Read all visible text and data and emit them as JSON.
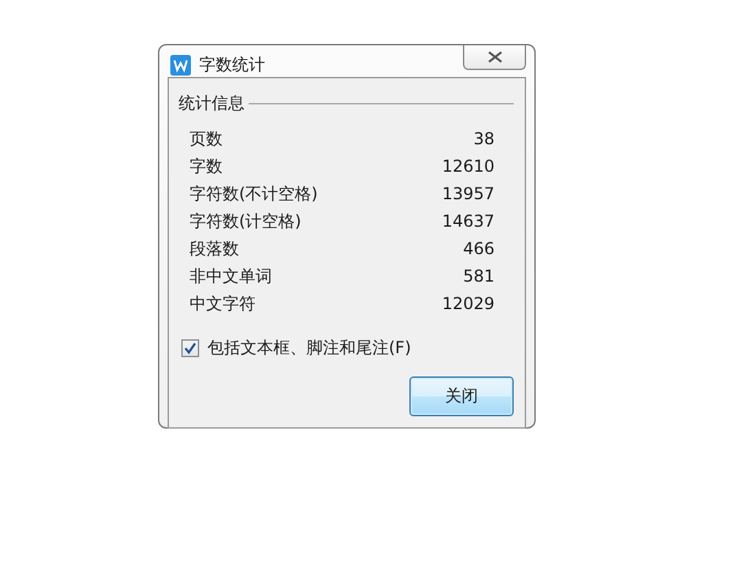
{
  "window": {
    "title": "字数统计"
  },
  "group": {
    "title": "统计信息"
  },
  "stats": [
    {
      "label": "页数",
      "value": "38"
    },
    {
      "label": "字数",
      "value": "12610"
    },
    {
      "label": "字符数(不计空格)",
      "value": "13957"
    },
    {
      "label": "字符数(计空格)",
      "value": "14637"
    },
    {
      "label": "段落数",
      "value": "466"
    },
    {
      "label": "非中文单词",
      "value": "581"
    },
    {
      "label": "中文字符",
      "value": "12029"
    }
  ],
  "include_option": {
    "label": "包括文本框、脚注和尾注(F)",
    "checked": true
  },
  "buttons": [
    {
      "label": "关闭"
    }
  ]
}
